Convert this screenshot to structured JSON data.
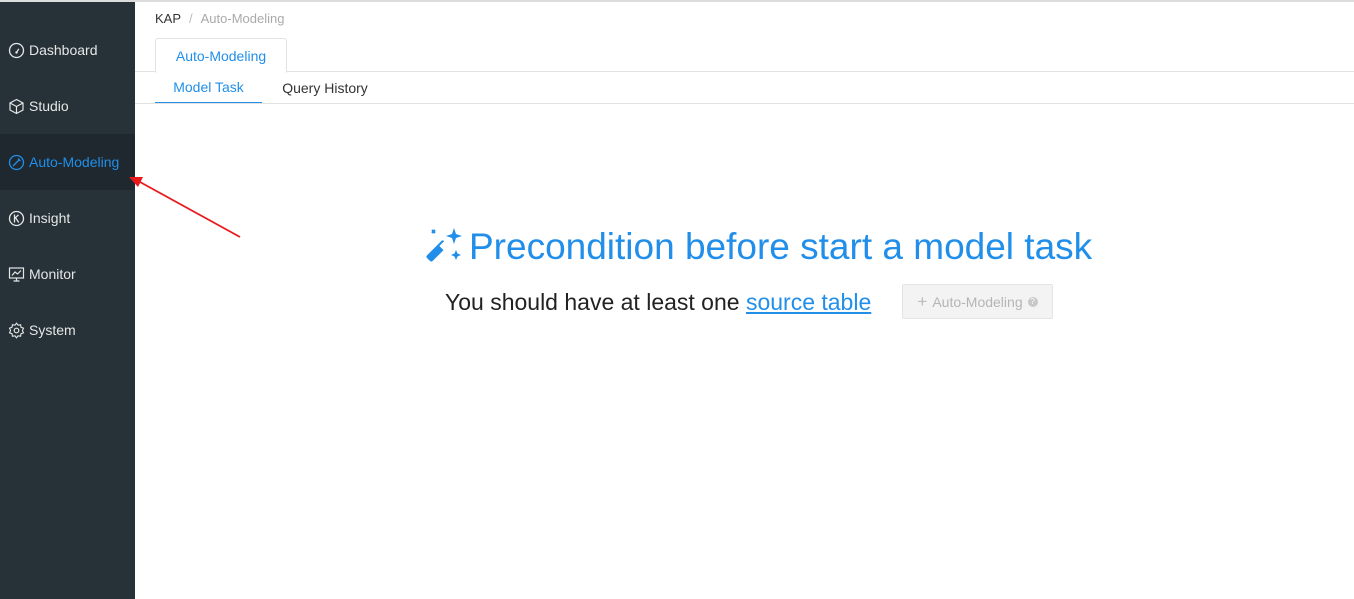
{
  "sidebar": {
    "items": [
      {
        "label": "Dashboard",
        "icon": "dashboard-icon"
      },
      {
        "label": "Studio",
        "icon": "cube-icon"
      },
      {
        "label": "Auto-Modeling",
        "icon": "auto-modeling-icon",
        "active": true
      },
      {
        "label": "Insight",
        "icon": "insight-icon"
      },
      {
        "label": "Monitor",
        "icon": "monitor-icon"
      },
      {
        "label": "System",
        "icon": "gear-icon"
      }
    ]
  },
  "breadcrumb": {
    "root": "KAP",
    "separator": "/",
    "current": "Auto-Modeling"
  },
  "tabs": {
    "outer": "Auto-Modeling",
    "model_task": "Model Task",
    "query_history": "Query History"
  },
  "main": {
    "title": "Precondition before start a model task",
    "subtitle_prefix": "You should have at least one",
    "subtitle_link": "source table",
    "button_label": "Auto-Modeling",
    "button_plus": "+",
    "help_glyph": "?"
  },
  "colors": {
    "accent": "#218fea",
    "sidebar_bg": "#263238",
    "annotation_arrow": "#e8191c"
  }
}
